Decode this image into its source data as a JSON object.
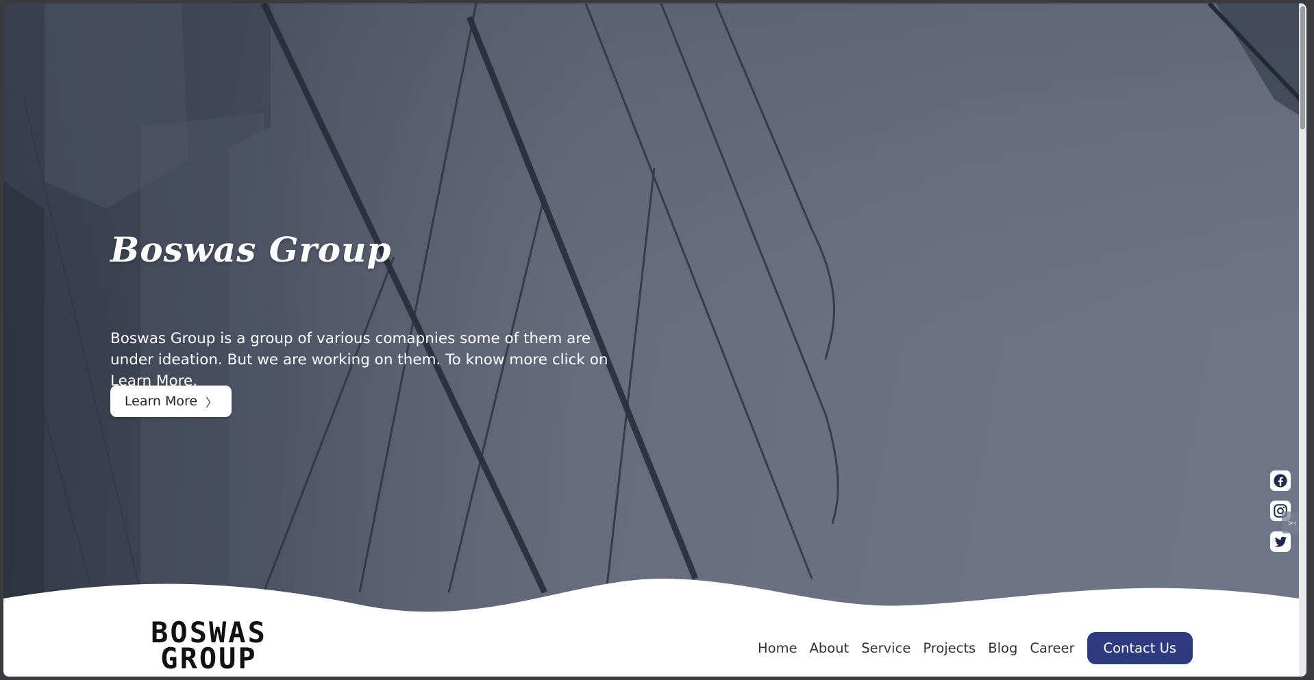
{
  "hero": {
    "title": "Boswas Group",
    "description": "Boswas Group is a group of various comapnies some of them are under ideation. But we are working on them. To know more click on Learn More.",
    "cta_label": "Learn More",
    "cta_icon": "chevron-right-icon"
  },
  "social": [
    {
      "name": "facebook",
      "icon": "facebook-icon"
    },
    {
      "name": "instagram",
      "icon": "instagram-icon"
    },
    {
      "name": "twitter",
      "icon": "twitter-icon"
    }
  ],
  "scroll_tab_label": ">‹",
  "logo": {
    "line1": "BOSWAS",
    "line2": "GROUP"
  },
  "nav": {
    "items": [
      "Home",
      "About",
      "Service",
      "Projects",
      "Blog",
      "Career"
    ],
    "contact_label": "Contact Us"
  },
  "colors": {
    "accent": "#2f3b80",
    "hero_overlay": "#6b7283",
    "text_light": "#ffffff"
  }
}
